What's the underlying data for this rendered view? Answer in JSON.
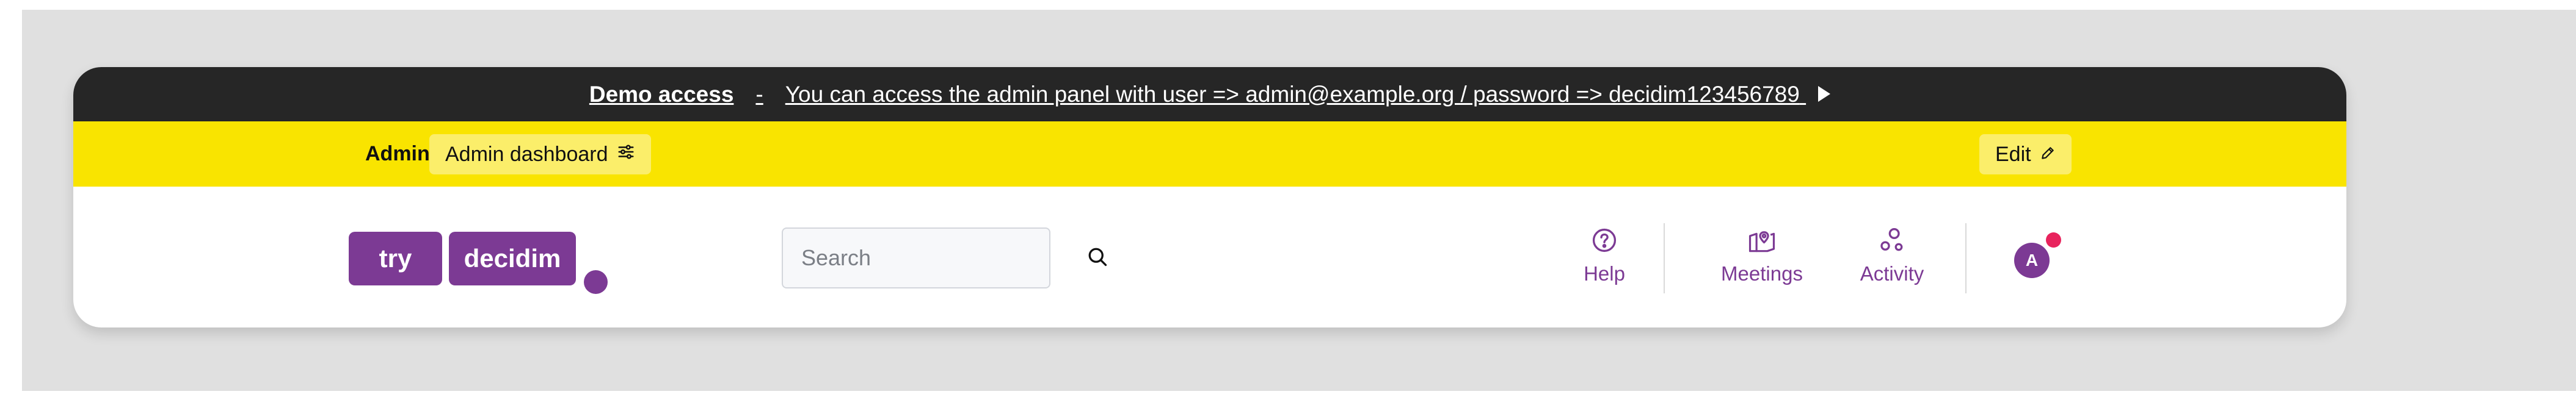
{
  "banner": {
    "title": "Demo access",
    "separator": "-",
    "message": "You can access the admin panel with user => admin@example.org / password => decidim123456789"
  },
  "admin_bar": {
    "label": "Admin",
    "dashboard_label": "Admin dashboard",
    "edit_label": "Edit"
  },
  "logo": {
    "part1": "try",
    "part2": "decidim"
  },
  "search": {
    "placeholder": "Search"
  },
  "nav": {
    "help": "Help",
    "meetings": "Meetings",
    "activity": "Activity"
  },
  "user": {
    "avatar_initial": "A"
  },
  "colors": {
    "banner_bg": "#262626",
    "admin_bar_bg": "#f9e400",
    "brand_purple": "#7c3a94",
    "notification": "#e8235d"
  }
}
